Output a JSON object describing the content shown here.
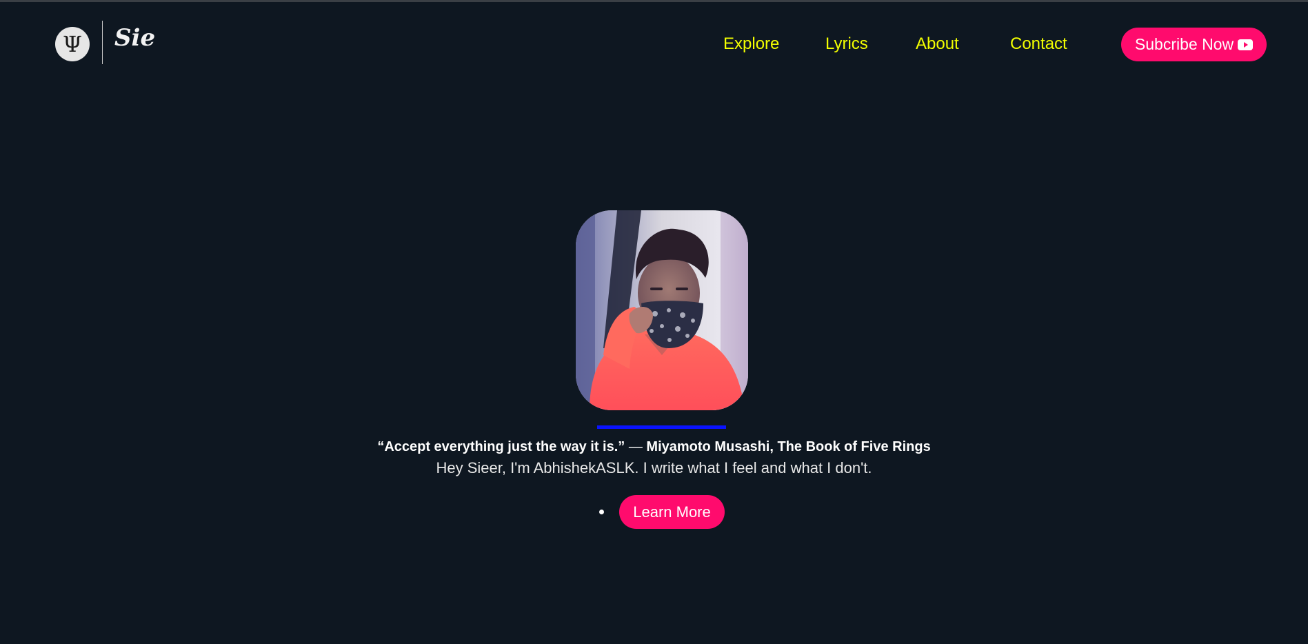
{
  "header": {
    "logo_symbol": "Ψ",
    "logo_text": "Sie",
    "nav": [
      {
        "label": "Explore"
      },
      {
        "label": "Lyrics"
      },
      {
        "label": "About"
      },
      {
        "label": "Contact"
      }
    ],
    "subscribe_label": "Subcribe Now",
    "subscribe_icon": "youtube-icon"
  },
  "hero": {
    "quote_text": "“Accept everything just the way it is.”",
    "quote_dash": "—",
    "quote_author": "Miyamoto Musashi, The Book of Five Rings",
    "intro": "Hey Sieer, I'm AbhishekASLK. I write what I feel and what I don't.",
    "learn_more_label": "Learn More"
  },
  "colors": {
    "background": "#0e1721",
    "nav_text": "#f3ff00",
    "accent_button": "#ff0b6d",
    "underline_bar": "#0a13ff"
  }
}
